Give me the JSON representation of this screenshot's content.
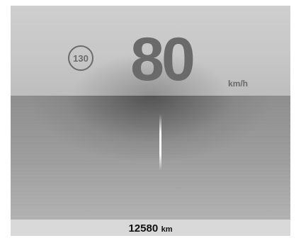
{
  "hud": {
    "speed_limit": "130",
    "speed": "80",
    "speed_unit": "km/h"
  },
  "odometer": {
    "value": "12580",
    "unit": "km"
  },
  "colors": {
    "text_dim": "#6a6a6a",
    "status_bar": "#d9d9d9",
    "lane_marker": "#ffffff"
  }
}
